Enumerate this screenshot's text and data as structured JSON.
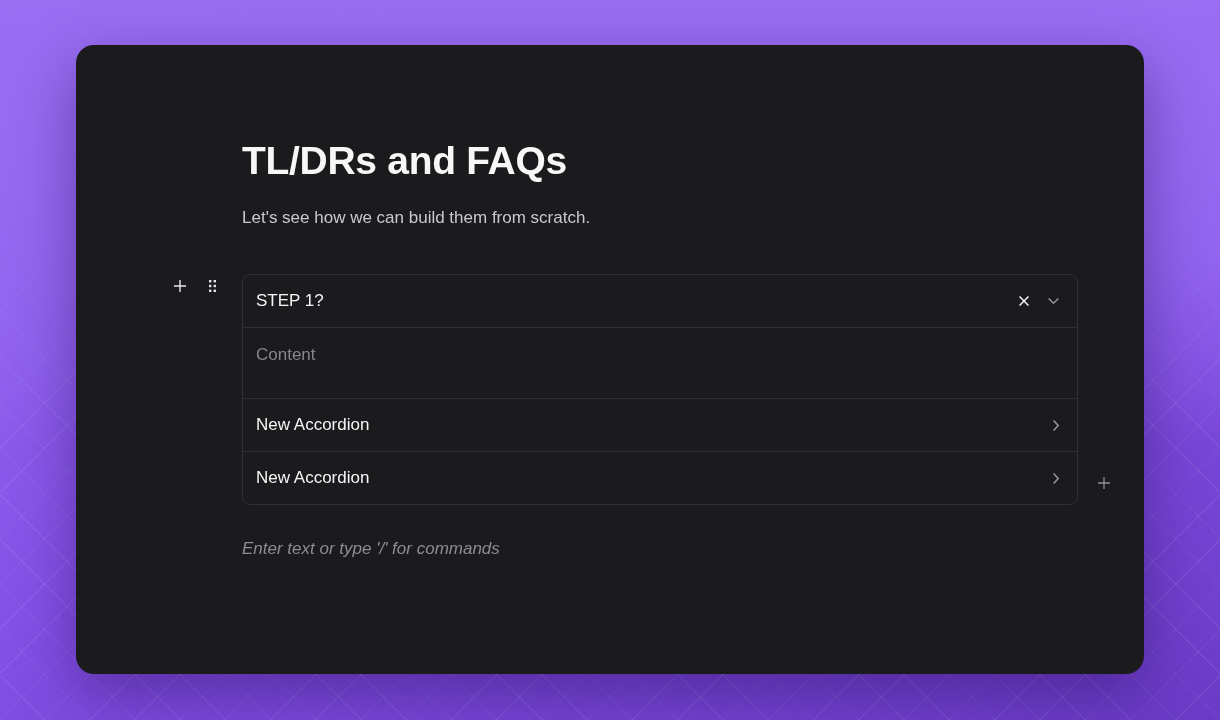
{
  "title": "TL/DRs and FAQs",
  "subtitle": "Let's see how we can build them from scratch.",
  "accordion": {
    "items": [
      {
        "title": "STEP 1?",
        "expanded": true,
        "content": {
          "placeholder": "Content"
        }
      },
      {
        "title": "New Accordion",
        "expanded": false
      },
      {
        "title": "New Accordion",
        "expanded": false
      }
    ]
  },
  "editor": {
    "placeholder": "Enter text or type '/' for commands"
  }
}
